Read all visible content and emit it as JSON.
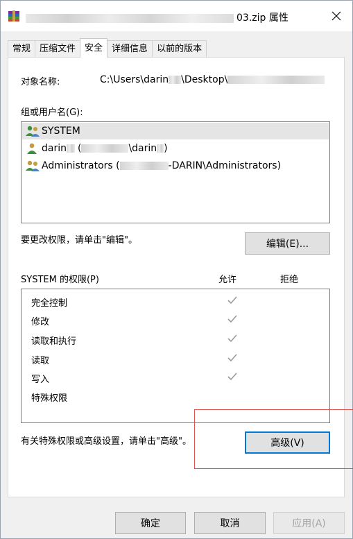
{
  "window": {
    "title_suffix": "03.zip 属性",
    "close_glyph": "✕"
  },
  "tabs": [
    {
      "label": "常规",
      "active": false
    },
    {
      "label": "压缩文件",
      "active": false
    },
    {
      "label": "安全",
      "active": true
    },
    {
      "label": "详细信息",
      "active": false
    },
    {
      "label": "以前的版本",
      "active": false
    }
  ],
  "security": {
    "object_name_label": "对象名称:",
    "object_name_value": "C:\\Users\\darin",
    "object_name_mid": "\\Desktop\\",
    "groups_label": "组或用户名(G):",
    "users": [
      {
        "name": "SYSTEM",
        "icon": "group-icon",
        "selected": true
      },
      {
        "name_a": "darin",
        "name_b": "(",
        "name_c": "\\darin",
        "name_d": ")",
        "icon": "user-icon",
        "selected": false
      },
      {
        "name_a": "Administrators (",
        "name_b": "-DARIN\\Administrators)",
        "icon": "group-icon",
        "selected": false
      }
    ],
    "change_text": "要更改权限，请单击\"编辑\"。",
    "edit_button": "编辑(E)...",
    "perm_header": "SYSTEM 的权限(P)",
    "allow_header": "允许",
    "deny_header": "拒绝",
    "permissions": [
      {
        "name": "完全控制",
        "allow": true
      },
      {
        "name": "修改",
        "allow": true
      },
      {
        "name": "读取和执行",
        "allow": true
      },
      {
        "name": "读取",
        "allow": true
      },
      {
        "name": "写入",
        "allow": true
      },
      {
        "name": "特殊权限",
        "allow": false
      }
    ],
    "advanced_text": "有关特殊权限或高级设置，请单击\"高级\"。",
    "advanced_button": "高级(V)"
  },
  "footer": {
    "ok_button": "确定",
    "cancel_button": "取消",
    "apply_button": "应用(A)"
  },
  "colors": {
    "focus_border": "#0078d7",
    "annotation": "#e0524f",
    "check": "#9a9a9a"
  }
}
